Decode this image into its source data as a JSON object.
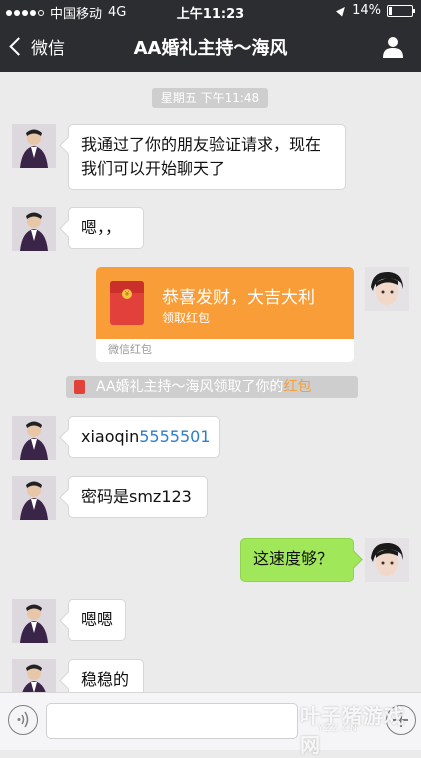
{
  "status_bar": {
    "carrier": "中国移动",
    "network": "4G",
    "time": "上午11:23",
    "battery": "14%",
    "battery_level": 0.14
  },
  "nav": {
    "back_label": "微信",
    "title": "AA婚礼主持～海风"
  },
  "chat": {
    "timestamp": "星期五 下午11:48",
    "messages": [
      {
        "text": "我通过了你的朋友验证请求，现在我们可以开始聊天了"
      },
      {
        "text": "嗯，，"
      },
      {
        "prefix": "xiaoqin",
        "link": "5555501"
      },
      {
        "text": "密码是smz123"
      },
      {
        "text": "这速度够？"
      },
      {
        "text": "嗯嗯"
      },
      {
        "text": "稳稳的"
      }
    ],
    "red_packet": {
      "title": "恭喜发财，大吉大利",
      "subtitle": "领取红包",
      "footer": "微信红包"
    },
    "system_note": {
      "text": "AA婚礼主持～海风领取了你的",
      "highlight": "红包"
    }
  },
  "input_bar": {
    "value": ""
  },
  "watermark": {
    "text": "叶子猪游戏网",
    "url": "YZZ.CN"
  },
  "colors": {
    "nav_bg": "#2c2d31",
    "chat_bg": "#ebebeb",
    "green_bubble": "#a0e75a",
    "red_packet": "#f89d37",
    "link": "#2d7ec8"
  }
}
